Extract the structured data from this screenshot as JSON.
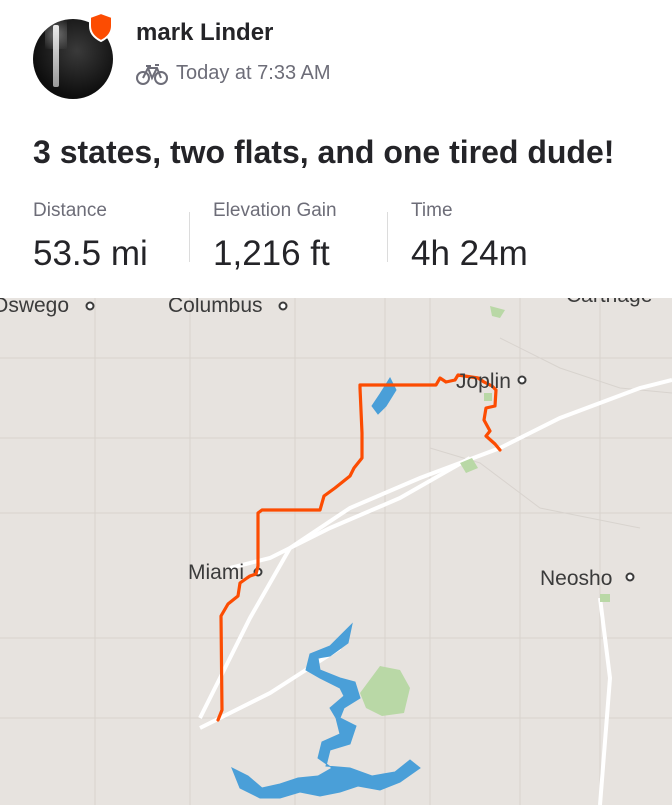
{
  "athlete": {
    "name": "mark Linder",
    "timestamp": "Today at 7:33 AM",
    "activity_icon": "bike-icon",
    "badge_icon": "shield-icon",
    "badge_color": "#fc4c02"
  },
  "activity": {
    "title": "3 states, two flats, and one tired dude!",
    "stats": [
      {
        "label": "Distance",
        "value": "53.5 mi"
      },
      {
        "label": "Elevation Gain",
        "value": "1,216 ft"
      },
      {
        "label": "Time",
        "value": "4h 24m"
      }
    ]
  },
  "map": {
    "route_color": "#fc4c02",
    "water_color": "#4a9fd8",
    "park_color": "#b9d8a6",
    "labels": {
      "oswego": "Oswego",
      "columbus": "Columbus",
      "carthage": "Carthage",
      "joplin": "Joplin",
      "miami": "Miami",
      "neosho": "Neosho"
    }
  }
}
